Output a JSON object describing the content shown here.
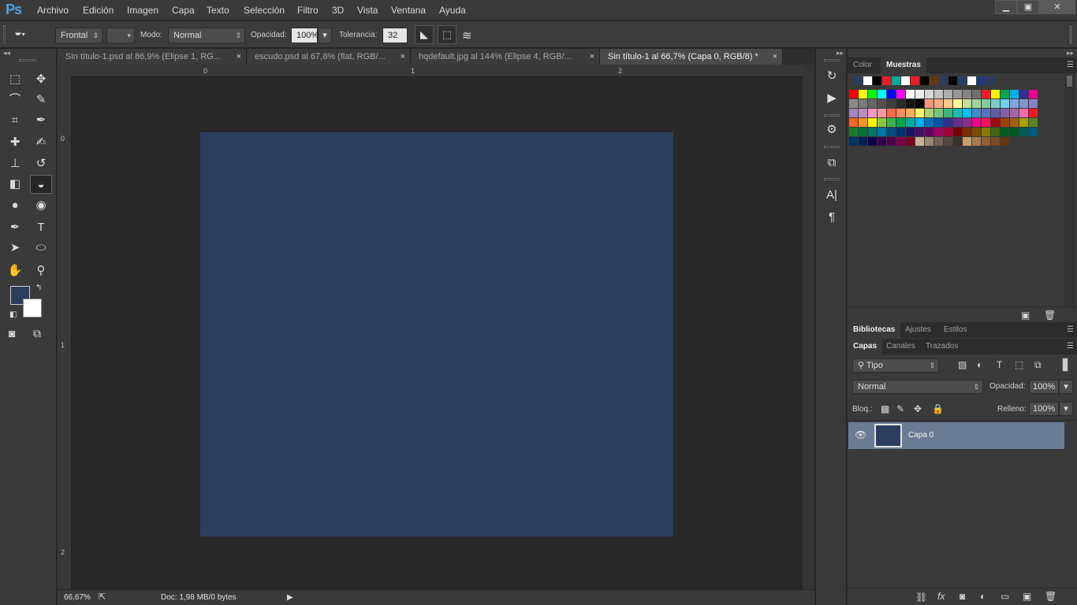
{
  "app": {
    "logo": "Ps"
  },
  "menu": [
    "Archivo",
    "Edición",
    "Imagen",
    "Capa",
    "Texto",
    "Selección",
    "Filtro",
    "3D",
    "Vista",
    "Ventana",
    "Ayuda"
  ],
  "window_controls": {
    "minimize": "▁",
    "restore": "▣",
    "close": "✕"
  },
  "options_bar": {
    "fill_source": "Frontal",
    "mode_label": "Modo:",
    "mode_value": "Normal",
    "opacity_label": "Opacidad:",
    "opacity_value": "100%",
    "tolerance_label": "Tolerancia:",
    "tolerance_value": "32"
  },
  "tabs": [
    {
      "label": "Sin título-1.psd al 86,9% (Elipse 1, RG...",
      "close": "×",
      "active": false
    },
    {
      "label": "escudo.psd al 67,8% (flat, RGB/...",
      "close": "×",
      "active": false
    },
    {
      "label": "hqdefault.jpg al 144% (Elipse 4, RGB/...",
      "close": "×",
      "active": false
    },
    {
      "label": "Sin título-1 al 66,7% (Capa 0, RGB/8) *",
      "close": "×",
      "active": true
    }
  ],
  "ruler": {
    "top_labels": [
      "0",
      "1",
      "2"
    ],
    "left_labels": [
      "0",
      "1",
      "2"
    ]
  },
  "canvas": {
    "fill_color": "#2b3e5f"
  },
  "status": {
    "zoom": "66,67%",
    "doc": "Doc: 1,98 MB/0 bytes",
    "arrow": "▶"
  },
  "tools": [
    [
      "rect-marquee-icon",
      "⬚",
      "move-icon",
      "✥"
    ],
    [
      "lasso-icon",
      "⌒",
      "quick-select-icon",
      "✎"
    ],
    [
      "crop-icon",
      "⌗",
      "eyedropper-icon",
      "✒"
    ],
    [
      "healing-brush-icon",
      "✚",
      "brush-icon",
      "✍"
    ],
    [
      "clone-stamp-icon",
      "⊥",
      "history-brush-icon",
      "↺"
    ],
    [
      "eraser-icon",
      "◧",
      "paint-bucket-icon",
      "◒"
    ],
    [
      "blur-icon",
      "●",
      "dodge-icon",
      "◉"
    ],
    [
      "pen-icon",
      "✒",
      "type-icon",
      "T"
    ],
    [
      "path-select-icon",
      "➤",
      "ellipse-icon",
      "⬭"
    ],
    [
      "hand-icon",
      "✋",
      "zoom-icon",
      "⚲"
    ]
  ],
  "colors": {
    "foreground": "#2b3e5f",
    "background": "#ffffff"
  },
  "dock_icons": [
    {
      "name": "history-icon",
      "glyph": "↻"
    },
    {
      "name": "play-action-icon",
      "glyph": "▶"
    },
    {
      "name": "info-icon",
      "glyph": "⚙"
    },
    {
      "name": "clone-source-icon",
      "glyph": "⧉"
    },
    {
      "name": "character-icon",
      "glyph": "A|"
    },
    {
      "name": "paragraph-icon",
      "glyph": "¶"
    }
  ],
  "color_panel": {
    "tabs": [
      "Color",
      "Muestras"
    ],
    "active": "Muestras"
  },
  "swatches": {
    "recent": [
      "#2b3e5f",
      "#ffffff",
      "#000000",
      "#ed1c24",
      "#00a99d",
      "#ffffff",
      "#ed1c24",
      "#000000",
      "#603913",
      "#2b3e5f",
      "#000000",
      "#2b3e5f",
      "#ffffff",
      "#1c3d7a",
      "#2b3e5f"
    ],
    "grid": [
      [
        "#ff0000",
        "#ffff00",
        "#00ff00",
        "#00ffff",
        "#0000ff",
        "#ff00ff",
        "#ffffff",
        "#ebebeb",
        "#d7d7d7",
        "#c2c2c2",
        "#adadad",
        "#999999",
        "#858585",
        "#707070",
        "#ed1c24",
        "#fff200",
        "#00a651",
        "#00aeef",
        "#2e3192",
        "#ec008c"
      ],
      [
        "#8c8c8c",
        "#7a7a7a",
        "#666666",
        "#525252",
        "#3d3d3d",
        "#292929",
        "#141414",
        "#000000",
        "#f7977a",
        "#f9ad81",
        "#fdc68a",
        "#fff79a",
        "#c4df9b",
        "#a3d39c",
        "#82ca9d",
        "#7bcdc8",
        "#6ecff6",
        "#7ea7d8",
        "#8493ca",
        "#8882be"
      ],
      [
        "#a187be",
        "#bc8dbf",
        "#f49ac2",
        "#f6989d",
        "#f26c4f",
        "#f68e55",
        "#fbaf5c",
        "#fff467",
        "#acd372",
        "#7cc576",
        "#3bb878",
        "#1abbb4",
        "#00bff3",
        "#438ccb",
        "#5574b9",
        "#605ca8",
        "#855fa8",
        "#a763a8",
        "#f06ea9",
        "#ed1c24"
      ],
      [
        "#f26522",
        "#f7941d",
        "#fff200",
        "#8dc63f",
        "#39b54a",
        "#00a651",
        "#00a99d",
        "#00aeef",
        "#0072bc",
        "#0054a6",
        "#2e3192",
        "#662d91",
        "#92278f",
        "#ec008c",
        "#ed145b",
        "#9e0b0f",
        "#a0410d",
        "#a36209",
        "#aba000",
        "#598527"
      ],
      [
        "#1a7b30",
        "#007236",
        "#00746b",
        "#0076a3",
        "#004b80",
        "#003471",
        "#1b1464",
        "#440e62",
        "#630460",
        "#9e005d",
        "#9e0039",
        "#790000",
        "#7b2e00",
        "#7d4900",
        "#827b00",
        "#406618",
        "#005e20",
        "#005826",
        "#005952",
        "#005b7f"
      ],
      [
        "#003663",
        "#002157",
        "#0d004c",
        "#32004b",
        "#4b0049",
        "#7b0046",
        "#7a0026",
        "#c7b299",
        "#998675",
        "#736357",
        "#534741",
        "#37302d",
        "#c69c6d",
        "#a67c52",
        "#8c6239",
        "#754c24",
        "#603913"
      ]
    ]
  },
  "libraries_panel": {
    "tabs": [
      "Bibliotecas",
      "Ajustes",
      "Estilos"
    ],
    "active": "Bibliotecas"
  },
  "layers_panel": {
    "tabs": [
      "Capas",
      "Canales",
      "Trazados"
    ],
    "active": "Capas",
    "filter": "Tipo",
    "blend_mode": "Normal",
    "opacity_label": "Opacidad:",
    "opacity_value": "100%",
    "lock_label": "Bloq.:",
    "fill_label": "Relleno:",
    "fill_value": "100%",
    "layers": [
      {
        "name": "Capa 0",
        "visible": true,
        "thumb_color": "#2b3e5f"
      }
    ]
  }
}
